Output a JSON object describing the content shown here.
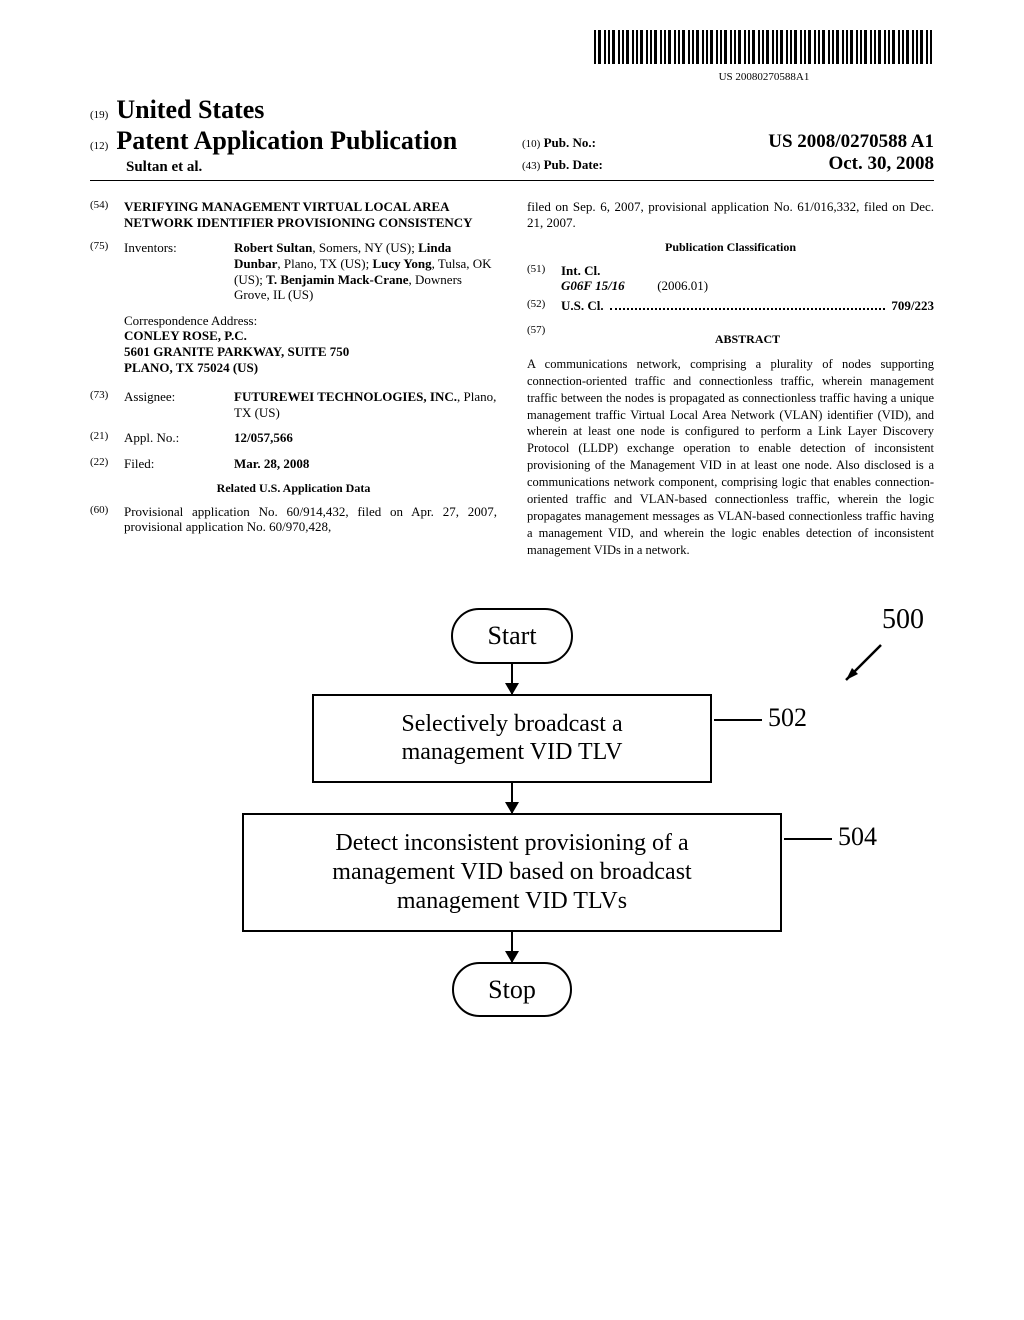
{
  "barcode_text": "US 20080270588A1",
  "header": {
    "line1_code": "(19)",
    "line1_value": "United States",
    "line2_code": "(12)",
    "line2_value": "Patent Application Publication",
    "authors": "Sultan et al.",
    "pubno_code": "(10)",
    "pubno_label": "Pub. No.:",
    "pubno_value": "US 2008/0270588 A1",
    "pubdate_code": "(43)",
    "pubdate_label": "Pub. Date:",
    "pubdate_value": "Oct. 30, 2008"
  },
  "left": {
    "title_code": "(54)",
    "title": "VERIFYING MANAGEMENT VIRTUAL LOCAL AREA NETWORK IDENTIFIER PROVISIONING CONSISTENCY",
    "inventors_code": "(75)",
    "inventors_label": "Inventors:",
    "inventors_value": "Robert Sultan, Somers, NY (US); Linda Dunbar, Plano, TX (US); Lucy Yong, Tulsa, OK (US); T. Benjamin Mack-Crane, Downers Grove, IL (US)",
    "correspondence_label": "Correspondence Address:",
    "correspondence_l1": "CONLEY ROSE, P.C.",
    "correspondence_l2": "5601 GRANITE PARKWAY, SUITE 750",
    "correspondence_l3": "PLANO, TX 75024 (US)",
    "assignee_code": "(73)",
    "assignee_label": "Assignee:",
    "assignee_value": "FUTUREWEI TECHNOLOGIES, INC., Plano, TX (US)",
    "applno_code": "(21)",
    "applno_label": "Appl. No.:",
    "applno_value": "12/057,566",
    "filed_code": "(22)",
    "filed_label": "Filed:",
    "filed_value": "Mar. 28, 2008",
    "related_heading": "Related U.S. Application Data",
    "prov_code": "(60)",
    "prov_text": "Provisional application No. 60/914,432, filed on Apr. 27, 2007, provisional application No. 60/970,428,"
  },
  "right": {
    "prov_cont": "filed on Sep. 6, 2007, provisional application No. 61/016,332, filed on Dec. 21, 2007.",
    "pubclass_heading": "Publication Classification",
    "intcl_code": "(51)",
    "intcl_label": "Int. Cl.",
    "intcl_value": "G06F 15/16",
    "intcl_year": "(2006.01)",
    "uscl_code": "(52)",
    "uscl_label": "U.S. Cl.",
    "uscl_value": "709/223",
    "abstract_code": "(57)",
    "abstract_heading": "ABSTRACT",
    "abstract_text": "A communications network, comprising a plurality of nodes supporting connection-oriented traffic and connectionless traffic, wherein management traffic between the nodes is propagated as connectionless traffic having a unique management traffic Virtual Local Area Network (VLAN) identifier (VID), and wherein at least one node is configured to perform a Link Layer Discovery Protocol (LLDP) exchange operation to enable detection of inconsistent provisioning of the Management VID in at least one node. Also disclosed is a communications network component, comprising logic that enables connection-oriented traffic and VLAN-based connectionless traffic, wherein the logic propagates management messages as VLAN-based connectionless traffic having a management VID, and wherein the logic enables detection of inconsistent management VIDs in a network."
  },
  "diagram": {
    "start": "Start",
    "box502": "Selectively broadcast a management VID TLV",
    "box504": "Detect inconsistent provisioning of a management VID based on broadcast management VID TLVs",
    "stop": "Stop",
    "ref502": "502",
    "ref504": "504",
    "ref500": "500"
  }
}
